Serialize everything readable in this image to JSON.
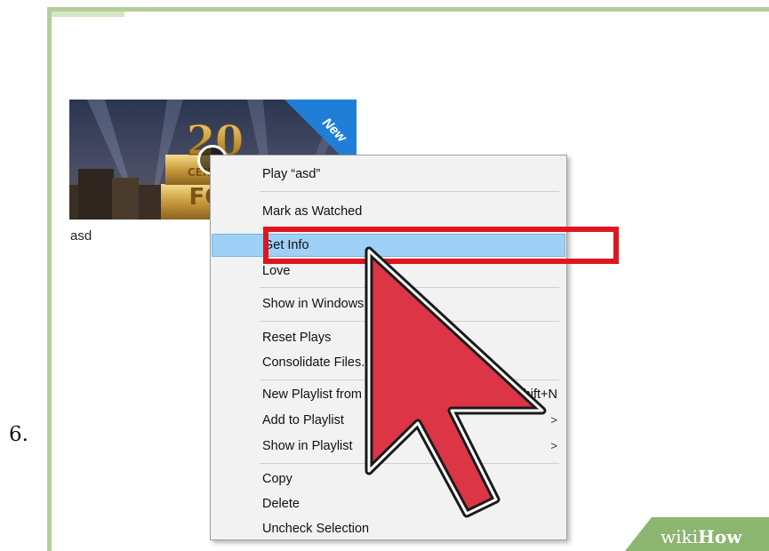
{
  "step": {
    "number": "6."
  },
  "library": {
    "item_title": "asd",
    "thumbnail": {
      "badge": "New",
      "play_icon": "play-icon",
      "logo_lettering": "20th Century Fox"
    }
  },
  "context_menu": {
    "items": [
      {
        "label": "Play “asd”"
      },
      {
        "label": "Mark as Watched"
      },
      {
        "label": "Get Info",
        "highlighted": true
      },
      {
        "label": "Love"
      },
      {
        "label": "Show in Windows Explorer"
      },
      {
        "label": "Reset Plays"
      },
      {
        "label": "Consolidate Files..."
      },
      {
        "label": "New Playlist from Selection",
        "shortcut": "Ctrl+Shift+N"
      },
      {
        "label": "Add to Playlist",
        "submenu": ">"
      },
      {
        "label": "Show in Playlist",
        "submenu": ">"
      },
      {
        "label": "Copy"
      },
      {
        "label": "Delete"
      },
      {
        "label": "Uncheck Selection"
      }
    ]
  },
  "annotation": {
    "highlight_color": "#e0161e",
    "pointer_color": "#dc3545",
    "pointer_icon": "cursor-arrow-icon"
  },
  "watermark": {
    "wiki": "wiki",
    "how": "How",
    "color": "#8cb570"
  },
  "colors": {
    "frame_border": "#b3ce9b",
    "menu_background": "#f2f2f2",
    "menu_highlight": "#9fd0f5",
    "new_badge": "#1f7fd8"
  }
}
